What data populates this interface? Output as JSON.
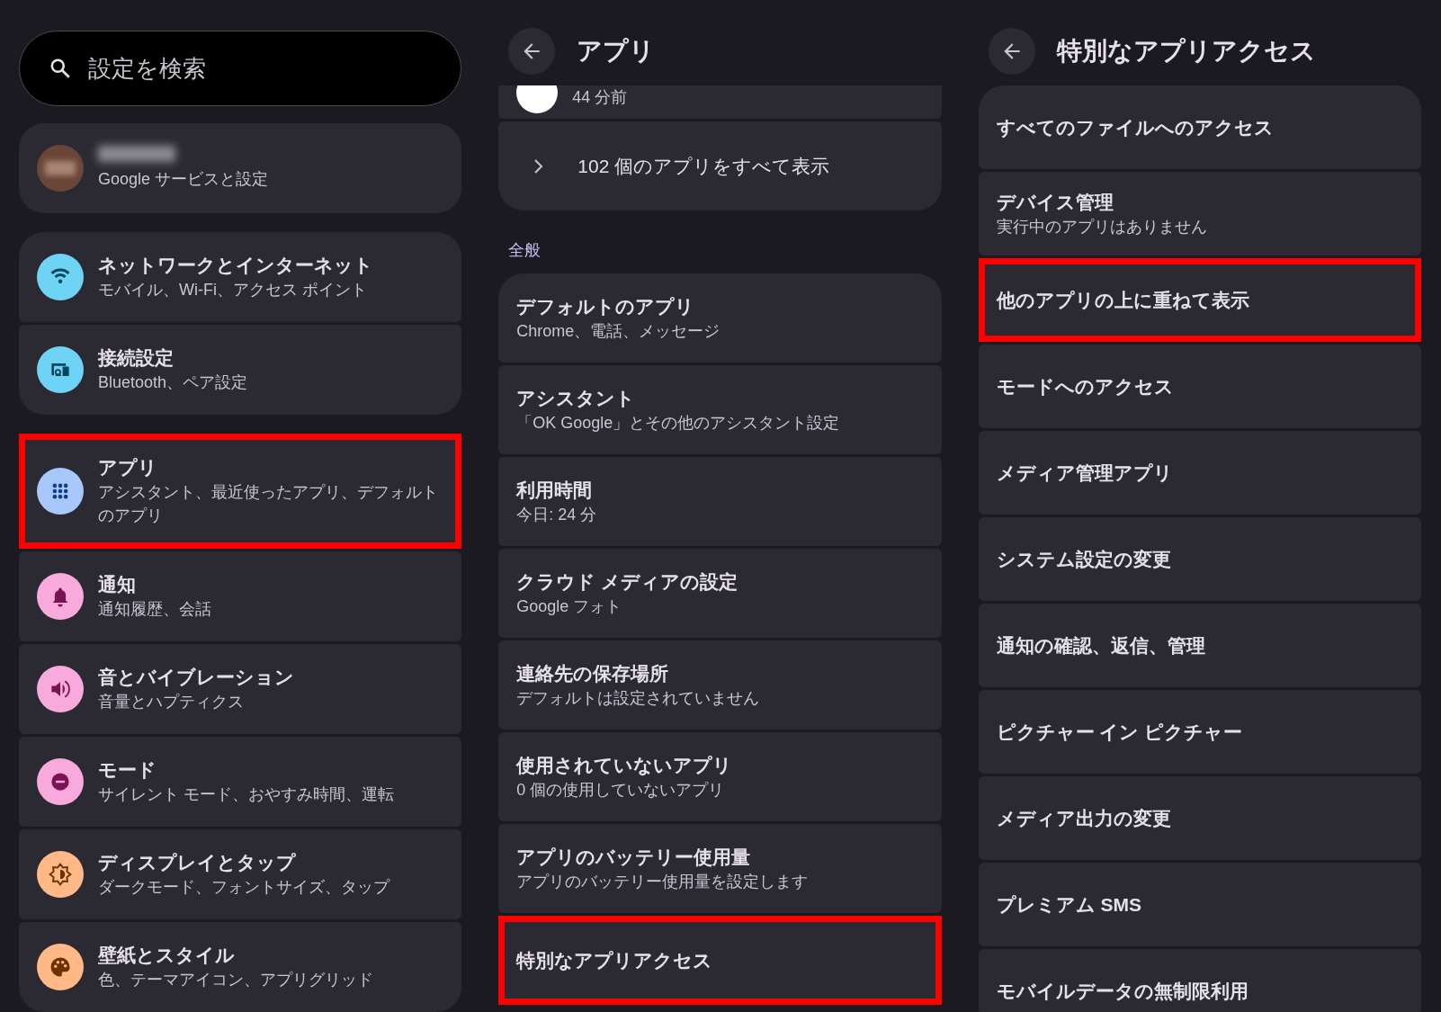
{
  "search": {
    "placeholder": "設定を検索"
  },
  "account": {
    "subtitle": "Google サービスと設定"
  },
  "settings_groups": [
    {
      "items": [
        {
          "kind": "wifi",
          "color": "#6fd3f5",
          "title": "ネットワークとインターネット",
          "subtitle": "モバイル、Wi-Fi、アクセス ポイント",
          "highlighted": false
        },
        {
          "kind": "devices",
          "color": "#6fd3f5",
          "title": "接続設定",
          "subtitle": "Bluetooth、ペア設定",
          "highlighted": false
        }
      ]
    },
    {
      "items": [
        {
          "kind": "apps",
          "color": "#a8c8fb",
          "title": "アプリ",
          "subtitle": "アシスタント、最近使ったアプリ、デフォルトのアプリ",
          "highlighted": true
        },
        {
          "kind": "bell",
          "color": "#f9aadc",
          "title": "通知",
          "subtitle": "通知履歴、会話",
          "highlighted": false
        },
        {
          "kind": "speaker",
          "color": "#f9aadc",
          "title": "音とバイブレーション",
          "subtitle": "音量とハプティクス",
          "highlighted": false
        },
        {
          "kind": "mode",
          "color": "#f9aadc",
          "title": "モード",
          "subtitle": "サイレント モード、おやすみ時間、運転",
          "highlighted": false
        },
        {
          "kind": "display",
          "color": "#ffb886",
          "title": "ディスプレイとタップ",
          "subtitle": "ダークモード、フォントサイズ、タップ",
          "highlighted": false
        },
        {
          "kind": "palette",
          "color": "#ffb886",
          "title": "壁紙とスタイル",
          "subtitle": "色、テーマアイコン、アプリグリッド",
          "highlighted": false
        }
      ]
    }
  ],
  "apps_page": {
    "title": "アプリ",
    "recent_partial": {
      "subtitle": "44 分前"
    },
    "see_all": "102 個のアプリをすべて表示",
    "section": "全般",
    "items": [
      {
        "title": "デフォルトのアプリ",
        "subtitle": "Chrome、電話、メッセージ",
        "highlighted": false
      },
      {
        "title": "アシスタント",
        "subtitle": "「OK Google」とその他のアシスタント設定",
        "highlighted": false
      },
      {
        "title": "利用時間",
        "subtitle": "今日: 24 分",
        "highlighted": false
      },
      {
        "title": "クラウド メディアの設定",
        "subtitle": "Google フォト",
        "highlighted": false
      },
      {
        "title": "連絡先の保存場所",
        "subtitle": "デフォルトは設定されていません",
        "highlighted": false
      },
      {
        "title": "使用されていないアプリ",
        "subtitle": "0 個の使用していないアプリ",
        "highlighted": false
      },
      {
        "title": "アプリのバッテリー使用量",
        "subtitle": "アプリのバッテリー使用量を設定します",
        "highlighted": false
      },
      {
        "title": "特別なアプリアクセス",
        "highlighted": true
      }
    ]
  },
  "special_access_page": {
    "title": "特別なアプリアクセス",
    "items": [
      {
        "title": "すべてのファイルへのアクセス",
        "highlighted": false
      },
      {
        "title": "デバイス管理",
        "subtitle": "実行中のアプリはありません",
        "highlighted": false
      },
      {
        "title": "他のアプリの上に重ねて表示",
        "highlighted": true
      },
      {
        "title": "モードへのアクセス",
        "highlighted": false
      },
      {
        "title": "メディア管理アプリ",
        "highlighted": false
      },
      {
        "title": "システム設定の変更",
        "highlighted": false
      },
      {
        "title": "通知の確認、返信、管理",
        "highlighted": false
      },
      {
        "title": "ピクチャー イン ピクチャー",
        "highlighted": false
      },
      {
        "title": "メディア出力の変更",
        "highlighted": false
      },
      {
        "title": "プレミアム SMS",
        "highlighted": false
      },
      {
        "title": "モバイルデータの無制限利用",
        "highlighted": false
      }
    ]
  }
}
